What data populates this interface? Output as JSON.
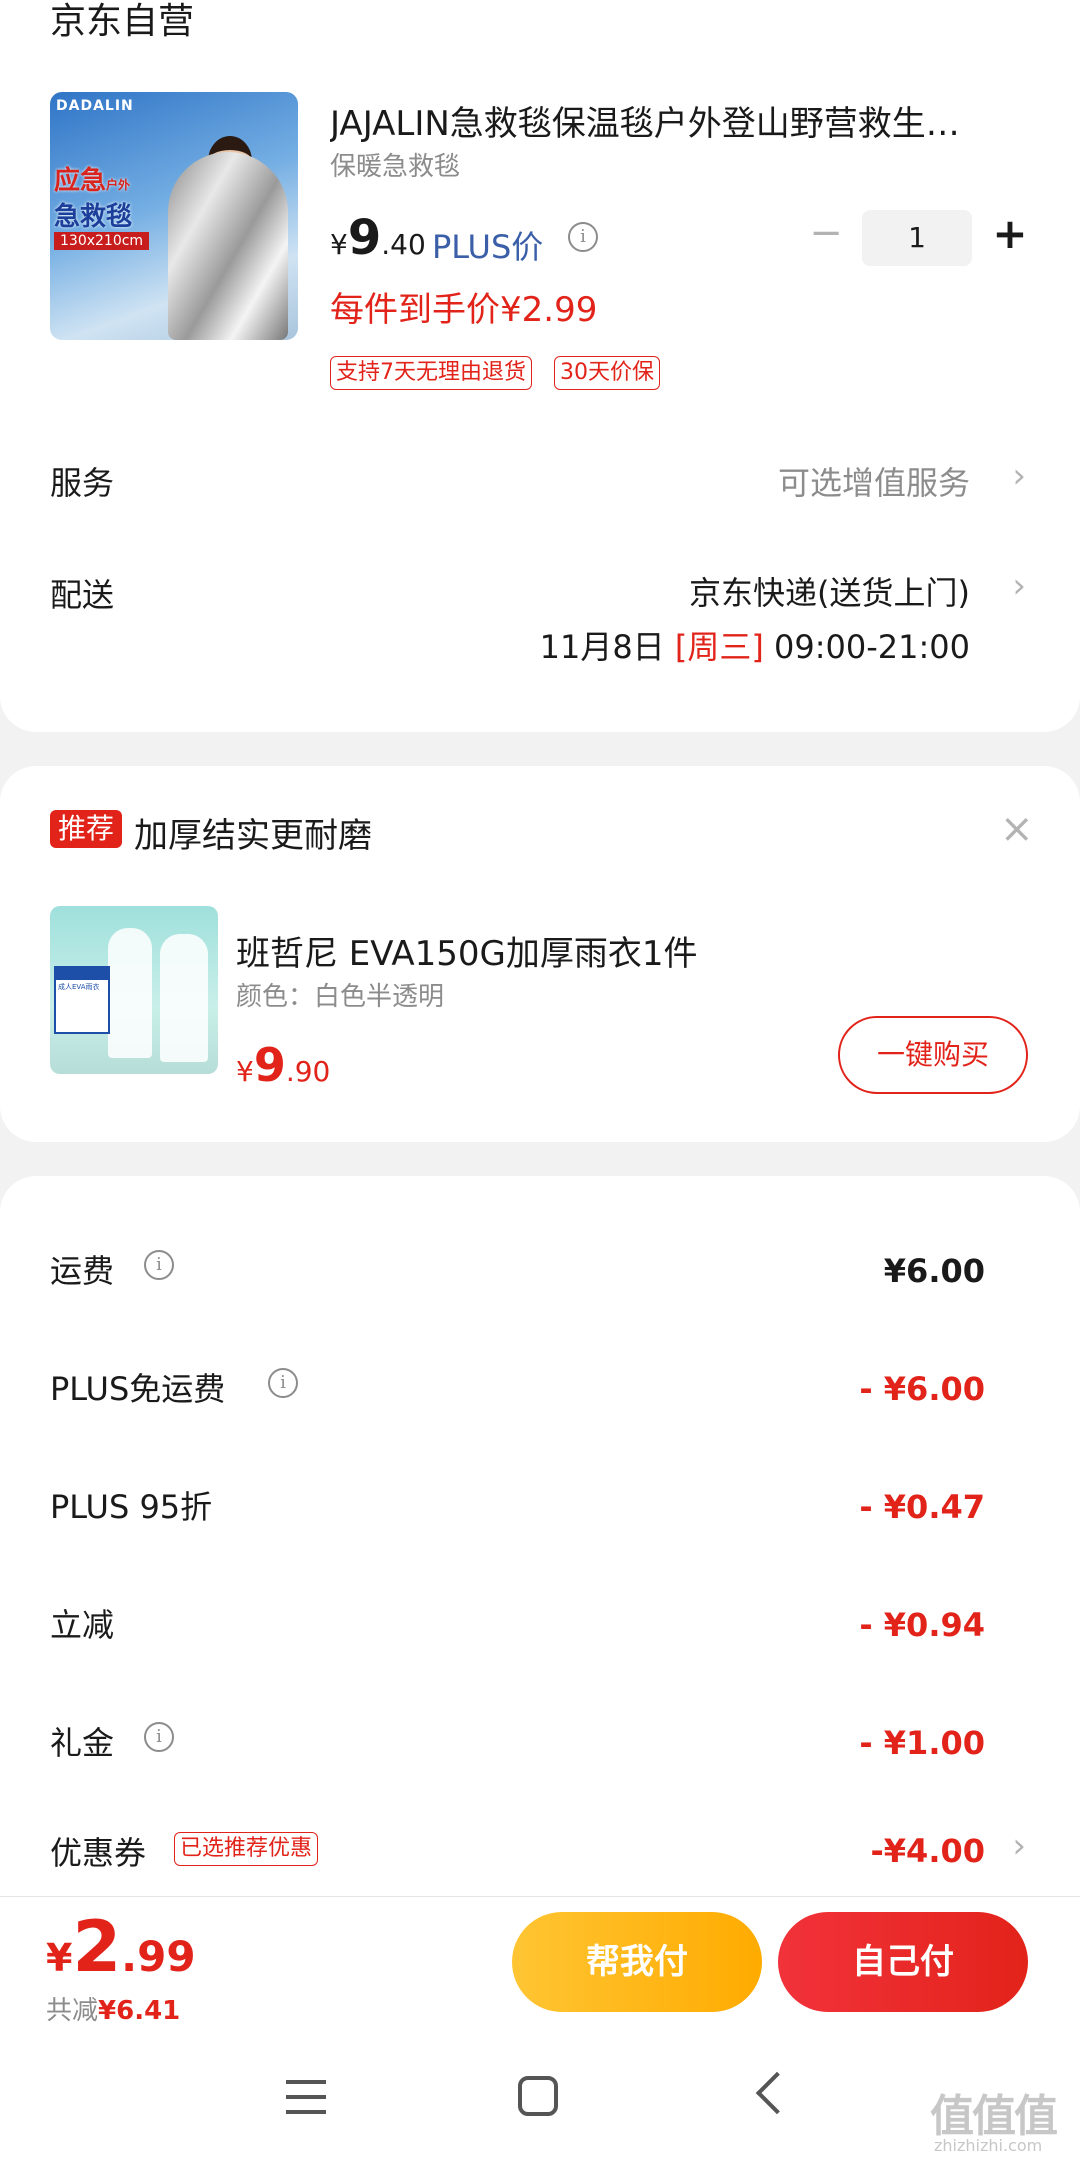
{
  "store_name": "京东自营",
  "product": {
    "title": "JAJALIN急救毯保温毯户外登山野营救生…",
    "spec": "保暖急救毯",
    "image_brand": "DADALIN",
    "image_text_red": "应急",
    "image_text_side": "户外",
    "image_text_blue": "急救毯",
    "image_text_size": "130x210cm",
    "price_symbol": "¥",
    "price_int": "9",
    "price_dec": ".40",
    "plus_label": "PLUS价",
    "quantity": "1",
    "final_price_label": "每件到手价¥2.99",
    "tags": [
      "支持7天无理由退货",
      "30天价保"
    ]
  },
  "service": {
    "label": "服务",
    "value": "可选增值服务"
  },
  "delivery": {
    "label": "配送",
    "carrier": "京东快递(送货上门)",
    "date": "11月8日",
    "weekday": "[周三]",
    "time": "09:00-21:00"
  },
  "recommendation": {
    "badge": "推荐",
    "title": "加厚结实更耐磨",
    "item_title": "班哲尼 EVA150G加厚雨衣1件",
    "item_spec": "颜色：白色半透明",
    "price_symbol": "¥",
    "price_int": "9",
    "price_dec": ".90",
    "buy_label": "一键购买",
    "image_card_text": "成人EVA雨衣"
  },
  "fees": [
    {
      "label": "运费",
      "value": "¥6.00",
      "negative": false,
      "info": true
    },
    {
      "label": "PLUS免运费",
      "value": "- ¥6.00",
      "negative": true,
      "info": true
    },
    {
      "label": "PLUS 95折",
      "value": "- ¥0.47",
      "negative": true,
      "info": false
    },
    {
      "label": "立减",
      "value": "- ¥0.94",
      "negative": true,
      "info": false
    },
    {
      "label": "礼金",
      "value": "- ¥1.00",
      "negative": true,
      "info": true
    },
    {
      "label": "优惠券",
      "value": "-¥4.00",
      "negative": true,
      "info": false
    }
  ],
  "coupon_tag": "已选推荐优惠",
  "footer": {
    "total_symbol": "¥",
    "total_int": "2",
    "total_dec": ".99",
    "saved_label": "共减",
    "saved_amount": "¥6.41",
    "help_pay": "帮我付",
    "self_pay": "自己付"
  },
  "watermark": {
    "text": "值值值",
    "url": "zhizhizhi.com"
  },
  "colors": {
    "accent_red": "#e2231a",
    "plus_blue": "#3a5fa8",
    "help_yellow": "#ffb400"
  }
}
